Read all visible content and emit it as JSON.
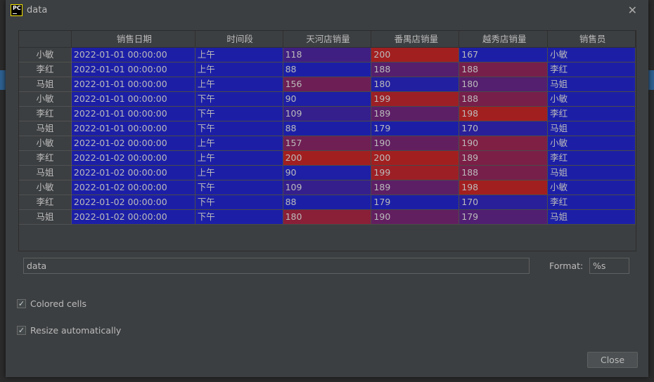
{
  "window": {
    "title": "data",
    "logo_text": "PC"
  },
  "colors": {
    "low": "#1c1fa6",
    "high": "#a21f20",
    "dialog_bg": "#3c3f41"
  },
  "table": {
    "columns": [
      "",
      "销售日期",
      "时间段",
      "天河店销量",
      "番禺店销量",
      "越秀店销量",
      "销售员"
    ],
    "numeric_columns": [
      3,
      4,
      5
    ],
    "rows": [
      [
        "小敏",
        "2022-01-01 00:00:00",
        "上午",
        "118",
        "200",
        "167",
        "小敏"
      ],
      [
        "李红",
        "2022-01-01 00:00:00",
        "上午",
        "88",
        "188",
        "188",
        "李红"
      ],
      [
        "马姐",
        "2022-01-01 00:00:00",
        "上午",
        "156",
        "180",
        "180",
        "马姐"
      ],
      [
        "小敏",
        "2022-01-01 00:00:00",
        "下午",
        "90",
        "199",
        "188",
        "小敏"
      ],
      [
        "李红",
        "2022-01-01 00:00:00",
        "下午",
        "109",
        "189",
        "198",
        "李红"
      ],
      [
        "马姐",
        "2022-01-01 00:00:00",
        "下午",
        "88",
        "179",
        "170",
        "马姐"
      ],
      [
        "小敏",
        "2022-01-02 00:00:00",
        "上午",
        "157",
        "190",
        "190",
        "小敏"
      ],
      [
        "李红",
        "2022-01-02 00:00:00",
        "上午",
        "200",
        "200",
        "189",
        "李红"
      ],
      [
        "马姐",
        "2022-01-02 00:00:00",
        "上午",
        "90",
        "199",
        "188",
        "马姐"
      ],
      [
        "小敏",
        "2022-01-02 00:00:00",
        "下午",
        "109",
        "189",
        "198",
        "小敏"
      ],
      [
        "李红",
        "2022-01-02 00:00:00",
        "下午",
        "88",
        "179",
        "170",
        "李红"
      ],
      [
        "马姐",
        "2022-01-02 00:00:00",
        "下午",
        "180",
        "190",
        "179",
        "马姐"
      ]
    ]
  },
  "name_field": {
    "value": "data"
  },
  "format": {
    "label": "Format:",
    "value": "%s"
  },
  "options": {
    "colored_cells": {
      "label": "Colored cells",
      "checked": true
    },
    "resize_automatically": {
      "label": "Resize automatically",
      "checked": true
    }
  },
  "buttons": {
    "close": "Close"
  }
}
